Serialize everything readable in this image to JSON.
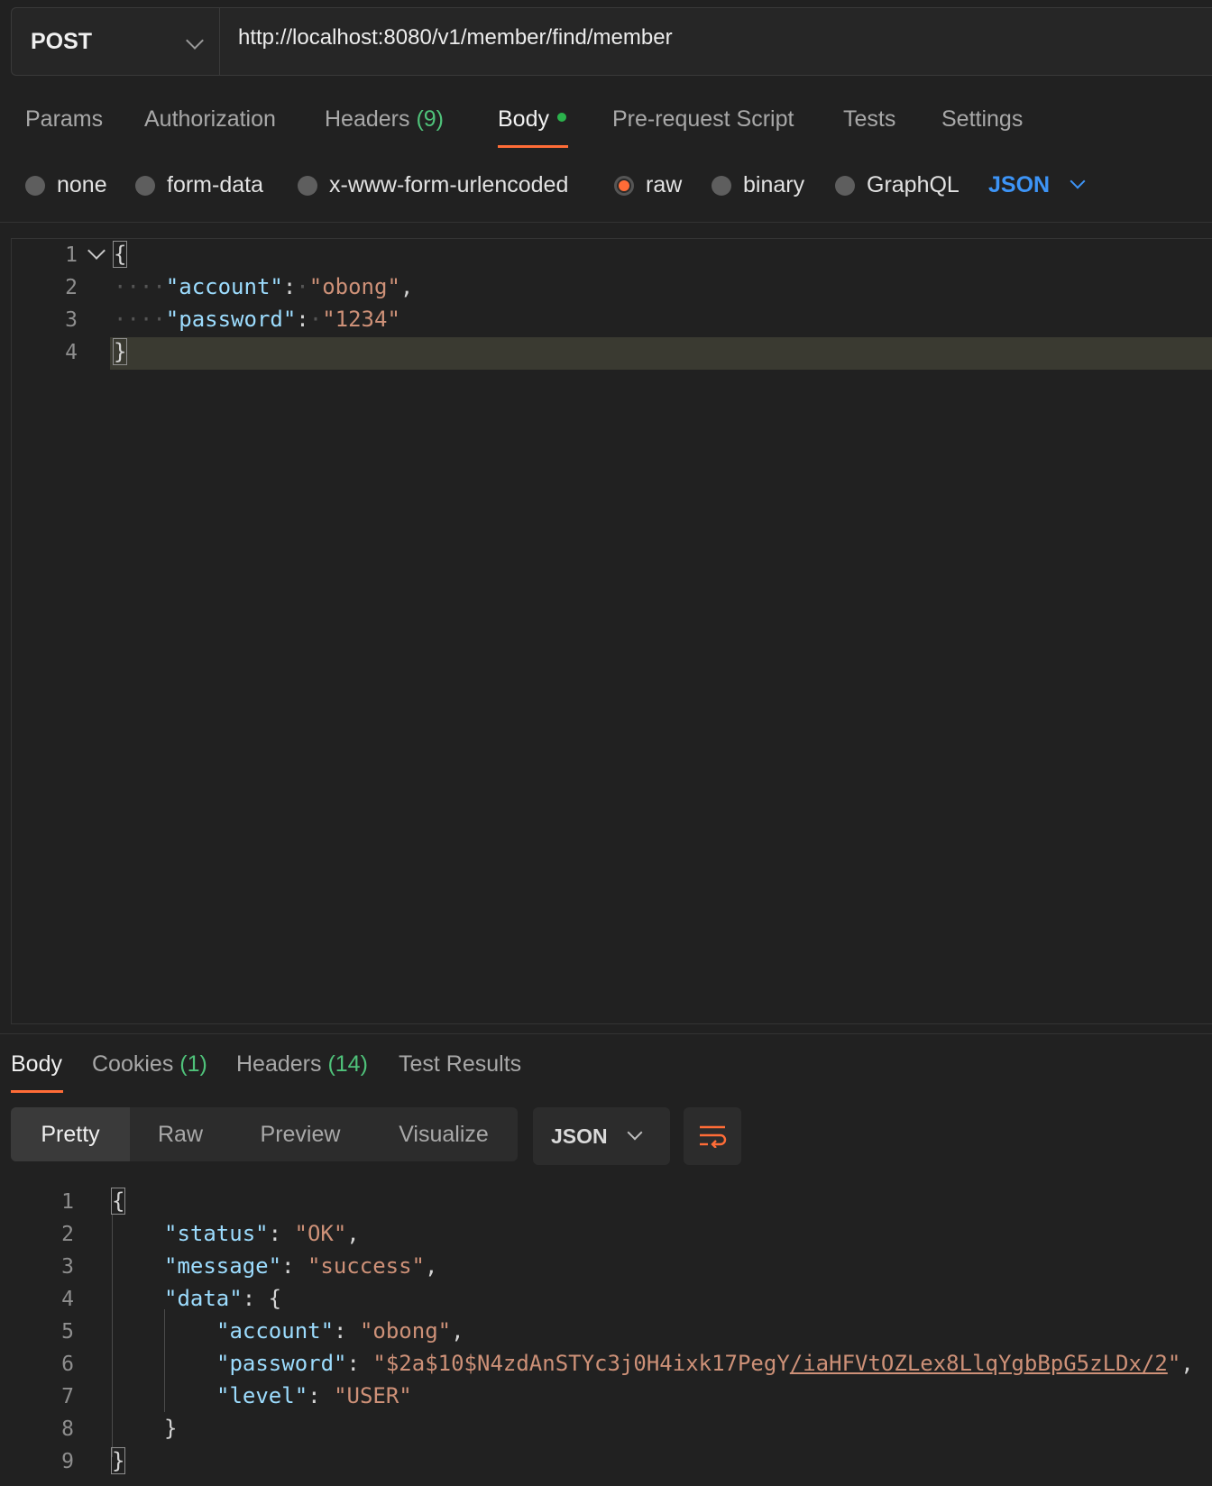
{
  "request": {
    "method": "POST",
    "url": "http://localhost:8080/v1/member/find/member"
  },
  "request_tabs": [
    {
      "label": "Params"
    },
    {
      "label": "Authorization"
    },
    {
      "label": "Headers",
      "count": "(9)"
    },
    {
      "label": "Body",
      "active": true
    },
    {
      "label": "Pre-request Script"
    },
    {
      "label": "Tests"
    },
    {
      "label": "Settings"
    }
  ],
  "body_types": {
    "options": [
      "none",
      "form-data",
      "x-www-form-urlencoded",
      "raw",
      "binary",
      "GraphQL"
    ],
    "selected": "raw",
    "format": "JSON"
  },
  "request_body": {
    "line_numbers": [
      "1",
      "2",
      "3",
      "4"
    ],
    "open": "{",
    "close": "}",
    "fields": [
      {
        "key": "\"account\"",
        "value": "\"obong\"",
        "trail": ","
      },
      {
        "key": "\"password\"",
        "value": "\"1234\"",
        "trail": ""
      }
    ]
  },
  "response_tabs": [
    {
      "label": "Body",
      "active": true
    },
    {
      "label": "Cookies",
      "count": "(1)"
    },
    {
      "label": "Headers",
      "count": "(14)"
    },
    {
      "label": "Test Results"
    }
  ],
  "response_view": {
    "modes": [
      "Pretty",
      "Raw",
      "Preview",
      "Visualize"
    ],
    "active_mode": "Pretty",
    "format": "JSON"
  },
  "response_body": {
    "line_numbers": [
      "1",
      "2",
      "3",
      "4",
      "5",
      "6",
      "7",
      "8",
      "9"
    ],
    "open": "{",
    "close": "}",
    "status_key": "\"status\"",
    "status_value": "\"OK\"",
    "message_key": "\"message\"",
    "message_value": "\"success\"",
    "data_key": "\"data\"",
    "account_key": "\"account\"",
    "account_value": "\"obong\"",
    "password_key": "\"password\"",
    "password_value_prefix": "\"$2a$10$N4zdAnSTYc3j0H4ixk17PegY",
    "password_value_link": "/iaHFVtOZLex8LlqYgbBpG5zLDx/2",
    "password_value_suffix": "\"",
    "level_key": "\"level\"",
    "level_value": "\"USER\"",
    "inner_close": "}"
  }
}
